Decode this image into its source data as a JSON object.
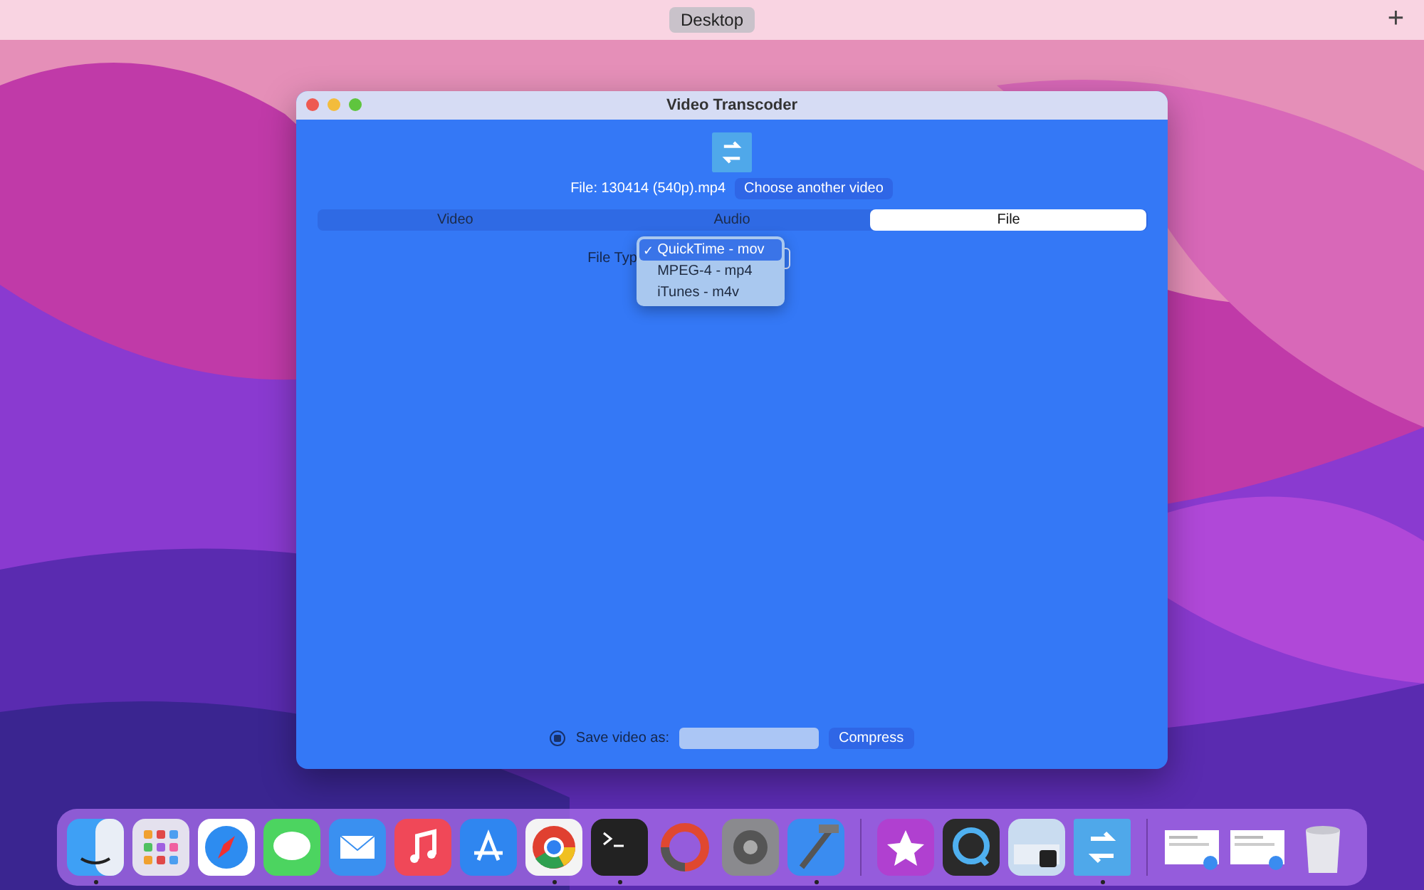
{
  "menu_bar": {
    "space_label": "Desktop",
    "add_button": "+"
  },
  "window": {
    "title": "Video Transcoder",
    "file_label": "File: 130414 (540p).mp4",
    "choose_button": "Choose another video",
    "tabs": [
      {
        "label": "Video",
        "selected": false
      },
      {
        "label": "Audio",
        "selected": false
      },
      {
        "label": "File",
        "selected": true
      }
    ],
    "file_type_label": "File Typ",
    "check_mark": "✓",
    "file_type_menu": [
      {
        "label": "QuickTime - mov",
        "checked": true
      },
      {
        "label": "MPEG-4 - mp4",
        "checked": false
      },
      {
        "label": "iTunes - m4v",
        "checked": false
      }
    ],
    "save": {
      "checked": true,
      "label": "Save video as:"
    },
    "compress_button": "Compress"
  },
  "dock": [
    {
      "kind": "finder",
      "running": true
    },
    {
      "kind": "launchpad",
      "running": false
    },
    {
      "kind": "safari",
      "running": false
    },
    {
      "kind": "messages",
      "running": false
    },
    {
      "kind": "mail",
      "running": false
    },
    {
      "kind": "music",
      "running": false
    },
    {
      "kind": "appstore",
      "running": false
    },
    {
      "kind": "chrome",
      "running": true
    },
    {
      "kind": "terminal",
      "running": true
    },
    {
      "kind": "ring",
      "running": false
    },
    {
      "kind": "settings",
      "running": false
    },
    {
      "kind": "xcode",
      "running": true
    },
    {
      "kind": "separator"
    },
    {
      "kind": "star",
      "running": false
    },
    {
      "kind": "quicktime",
      "running": false
    },
    {
      "kind": "preview",
      "running": false
    },
    {
      "kind": "transcoder",
      "running": true
    },
    {
      "kind": "separator"
    },
    {
      "kind": "window",
      "running": false
    },
    {
      "kind": "window",
      "running": false
    },
    {
      "kind": "trash",
      "running": false
    }
  ]
}
